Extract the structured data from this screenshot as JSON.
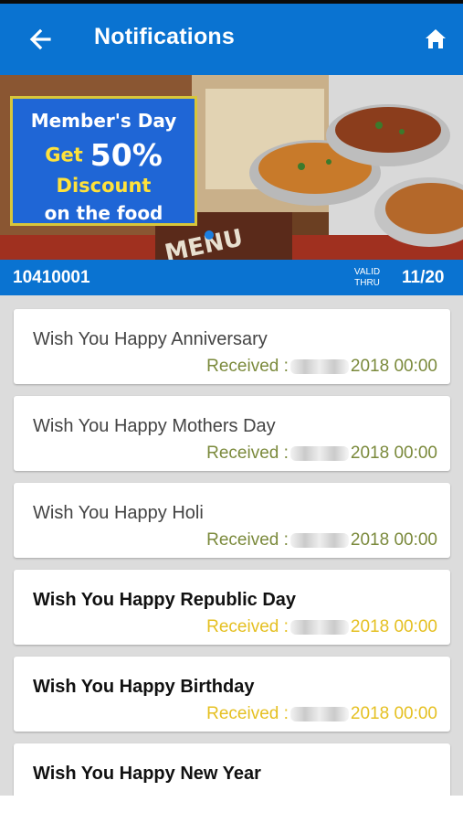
{
  "app_bar": {
    "title": "Notifications",
    "color": "#0a73d1"
  },
  "banner": {
    "line1": "Member's Day",
    "get": "Get",
    "percent": "50%",
    "line3": "Discount",
    "line4": "on the food",
    "menu_text": "MENU"
  },
  "card_strip": {
    "card_number": "10410001",
    "valid_label_1": "VALID",
    "valid_label_2": "THRU",
    "expiry": "11/20"
  },
  "notifications": [
    {
      "title": "Wish You Happy Anniversary",
      "received_label": "Received :",
      "year_time": "2018 00:00",
      "read": true
    },
    {
      "title": "Wish You Happy Mothers Day",
      "received_label": "Received :",
      "year_time": "2018 00:00",
      "read": true
    },
    {
      "title": "Wish You Happy Holi",
      "received_label": "Received :",
      "year_time": "2018 00:00",
      "read": true
    },
    {
      "title": "Wish You Happy Republic Day",
      "received_label": "Received :",
      "year_time": "2018 00:00",
      "read": false
    },
    {
      "title": "Wish You Happy Birthday",
      "received_label": "Received :",
      "year_time": "2018 00:00",
      "read": false
    },
    {
      "title": "Wish You Happy New Year",
      "received_label": "",
      "year_time": "",
      "read": false
    }
  ],
  "colors": {
    "read_received": "#7b8a3c",
    "unread_received": "#e5c022"
  }
}
